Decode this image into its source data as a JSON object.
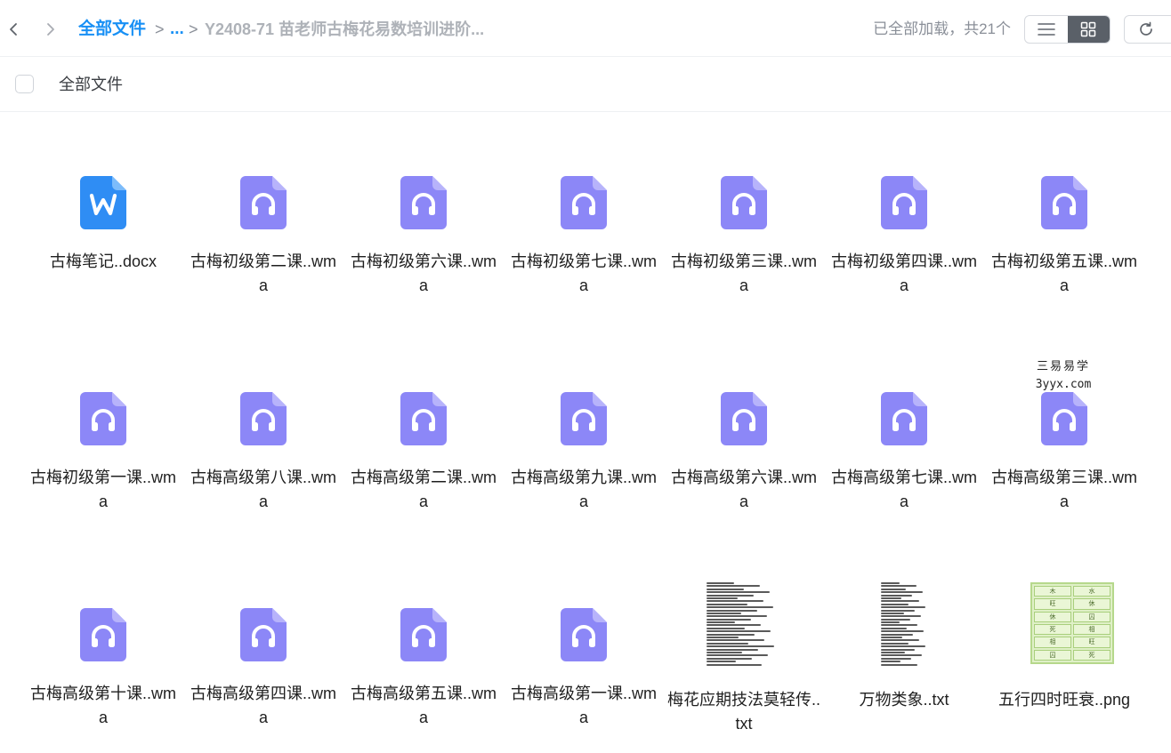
{
  "toolbar": {
    "breadcrumb_root": "全部文件",
    "breadcrumb_separator": ">",
    "breadcrumb_ellipsis": "...",
    "breadcrumb_current": "Y2408-71 苗老师古梅花易数培训进阶...",
    "status_text": "已全部加载，共21个",
    "list_view_icon": "list-icon",
    "grid_view_icon": "grid-icon",
    "active_view": "grid",
    "refresh_icon": "refresh-icon"
  },
  "list_header": {
    "label": "全部文件"
  },
  "colors": {
    "accent": "#1890f5",
    "audio_icon": "#8c87f7",
    "word_icon": "#2f8df4"
  },
  "files": [
    {
      "name": "古梅笔记..docx",
      "type": "docx"
    },
    {
      "name": "古梅初级第二课..wma",
      "type": "wma"
    },
    {
      "name": "古梅初级第六课..wma",
      "type": "wma"
    },
    {
      "name": "古梅初级第七课..wma",
      "type": "wma"
    },
    {
      "name": "古梅初级第三课..wma",
      "type": "wma"
    },
    {
      "name": "古梅初级第四课..wma",
      "type": "wma"
    },
    {
      "name": "古梅初级第五课..wma",
      "type": "wma"
    },
    {
      "name": "古梅初级第一课..wma",
      "type": "wma"
    },
    {
      "name": "古梅高级第八课..wma",
      "type": "wma"
    },
    {
      "name": "古梅高级第二课..wma",
      "type": "wma"
    },
    {
      "name": "古梅高级第九课..wma",
      "type": "wma"
    },
    {
      "name": "古梅高级第六课..wma",
      "type": "wma"
    },
    {
      "name": "古梅高级第七课..wma",
      "type": "wma"
    },
    {
      "name": "古梅高级第三课..wma",
      "type": "wma"
    },
    {
      "name": "古梅高级第十课..wma",
      "type": "wma"
    },
    {
      "name": "古梅高级第四课..wma",
      "type": "wma"
    },
    {
      "name": "古梅高级第五课..wma",
      "type": "wma"
    },
    {
      "name": "古梅高级第一课..wma",
      "type": "wma"
    },
    {
      "name": "梅花应期技法莫轻传..txt",
      "type": "txt"
    },
    {
      "name": "万物类象..txt",
      "type": "txt"
    },
    {
      "name": "五行四时旺衰..png",
      "type": "png"
    }
  ],
  "png_thumbnail_cells": [
    "木",
    "水",
    "旺",
    "休",
    "休",
    "囚",
    "死",
    "相",
    "相",
    "旺",
    "囚",
    "死"
  ],
  "watermark": {
    "line1": "三易易学",
    "line2": "3yyx.com"
  }
}
